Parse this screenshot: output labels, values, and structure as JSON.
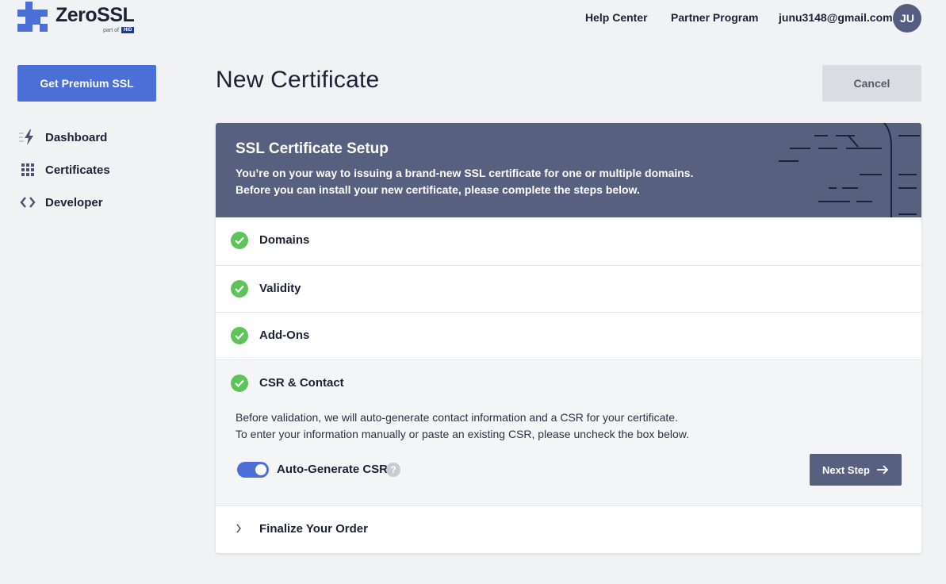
{
  "brand": {
    "name": "ZeroSSL",
    "sub_prefix": "part of",
    "sub_badge": "HID",
    "accent": "#4b6fd6"
  },
  "topnav": {
    "help_center": "Help Center",
    "partner_program": "Partner Program",
    "email": "junu3148@gmail.com",
    "avatar_initials": "JU"
  },
  "sidebar": {
    "premium_button": "Get Premium SSL",
    "items": [
      {
        "label": "Dashboard",
        "icon": "bolt-icon"
      },
      {
        "label": "Certificates",
        "icon": "grid-dots-icon"
      },
      {
        "label": "Developer",
        "icon": "code-brackets-icon"
      }
    ]
  },
  "main": {
    "title": "New Certificate",
    "cancel": "Cancel",
    "banner": {
      "title": "SSL Certificate Setup",
      "line1": "You’re on your way to issuing a brand-new SSL certificate for one or multiple domains.",
      "line2": "Before you can install your new certificate, please complete the steps below."
    },
    "steps": [
      {
        "label": "Domains",
        "status": "complete"
      },
      {
        "label": "Validity",
        "status": "complete"
      },
      {
        "label": "Add-Ons",
        "status": "complete"
      },
      {
        "label": "CSR & Contact",
        "status": "active"
      },
      {
        "label": "Finalize Your Order",
        "status": "pending"
      }
    ],
    "csr": {
      "text1": "Before validation, we will auto-generate contact information and a CSR for your certificate.",
      "text2": "To enter your information manually or paste an existing CSR, please uncheck the box below.",
      "toggle_label": "Auto-Generate CSR",
      "toggle_on": true,
      "help": "?",
      "next_button": "Next Step"
    }
  }
}
